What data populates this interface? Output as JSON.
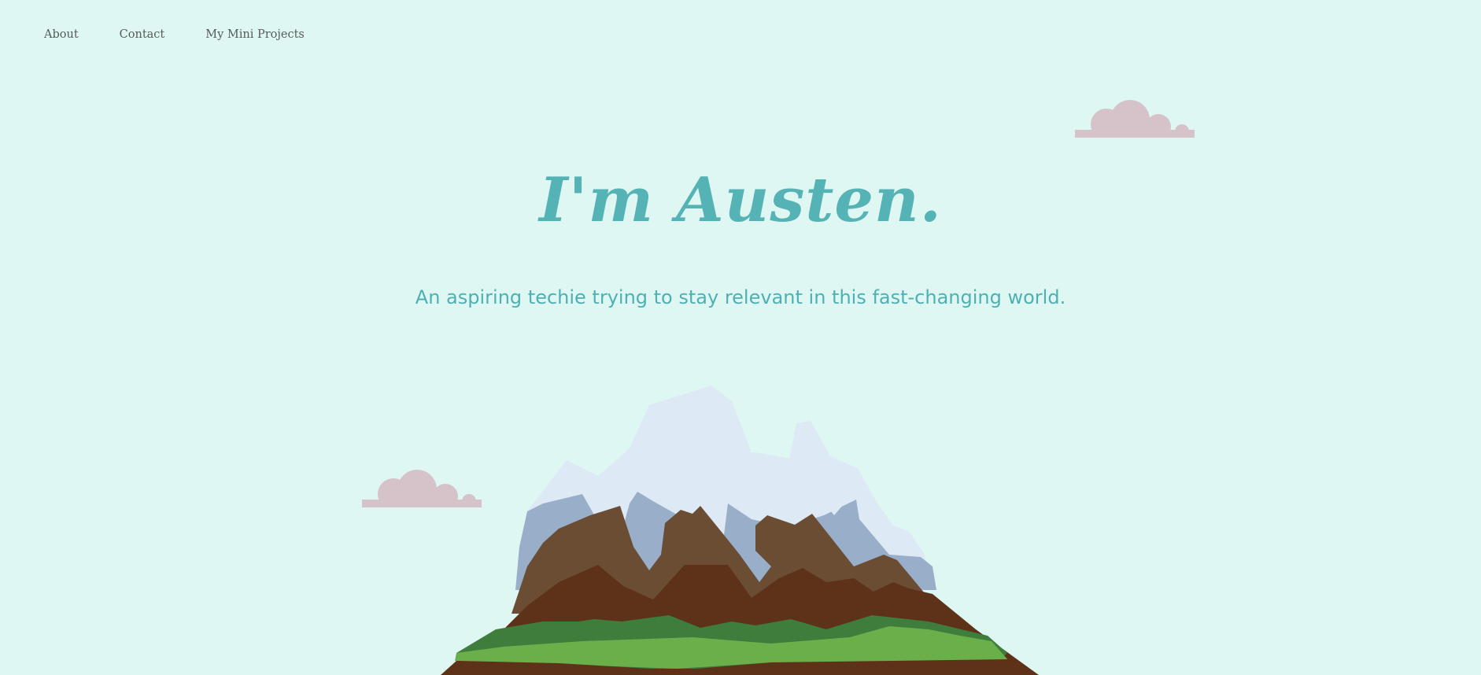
{
  "nav": {
    "items": [
      {
        "label": "About"
      },
      {
        "label": "Contact"
      },
      {
        "label": "My Mini Projects"
      }
    ]
  },
  "hero": {
    "title": "I'm Austen.",
    "subtitle": "An aspiring techie trying to stay relevant in this fast-changing world."
  },
  "colors": {
    "background": "#dff7f3",
    "accent": "#55b3b6",
    "cloud": "#d6c3ca",
    "snow": "#dde9f5",
    "rock_shadow": "#99aec8",
    "rock_light": "#6b4d34",
    "rock_dark": "#5d3219",
    "grass_dark": "#3f7d3d",
    "grass_light": "#6aaf4a"
  },
  "illustrations": {
    "clouds": [
      "cloud-icon",
      "cloud-icon"
    ],
    "mountain": "mountain-illustration"
  }
}
